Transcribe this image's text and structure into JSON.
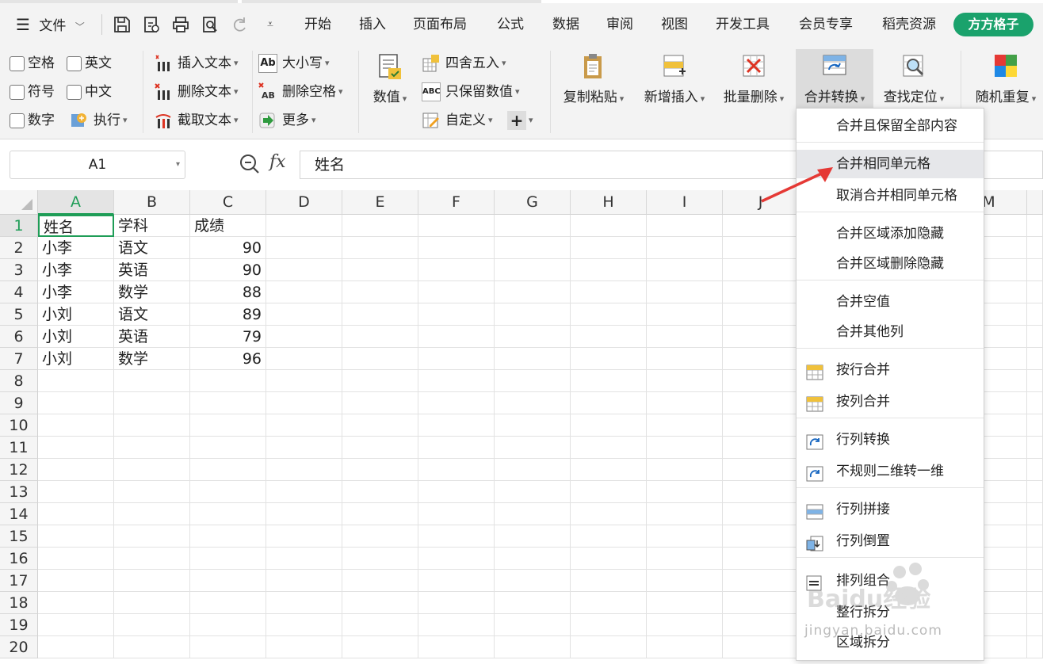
{
  "menu": {
    "file_label": "文件",
    "tabs": [
      "开始",
      "插入",
      "页面布局",
      "公式",
      "数据",
      "审阅",
      "视图",
      "开发工具",
      "会员专享",
      "稻壳资源"
    ],
    "brand": "方方格子"
  },
  "ribbon": {
    "checks": [
      "空格",
      "英文",
      "符号",
      "中文",
      "数字"
    ],
    "execute": "执行",
    "text_ops": [
      "插入文本",
      "删除文本",
      "截取文本"
    ],
    "case_ops": [
      "大小写",
      "删除空格",
      "更多"
    ],
    "value_label": "数值",
    "num_ops": [
      "四舍五入",
      "只保留数值",
      "自定义"
    ],
    "big_buttons": [
      "复制粘贴",
      "新增插入",
      "批量删除",
      "合并转换",
      "查找定位",
      "随机重复"
    ]
  },
  "formula_bar": {
    "cell_ref": "A1",
    "fx": "fx",
    "content": "姓名"
  },
  "columns": [
    "A",
    "B",
    "C",
    "D",
    "E",
    "F",
    "G",
    "H",
    "I",
    "J",
    "M"
  ],
  "rows": [
    "1",
    "2",
    "3",
    "4",
    "5",
    "6",
    "7",
    "8",
    "9",
    "10",
    "11",
    "12",
    "13",
    "14",
    "15",
    "16",
    "17",
    "18",
    "19",
    "20"
  ],
  "table": [
    [
      "姓名",
      "学科",
      "成绩"
    ],
    [
      "小李",
      "语文",
      "90"
    ],
    [
      "小李",
      "英语",
      "90"
    ],
    [
      "小李",
      "数学",
      "88"
    ],
    [
      "小刘",
      "语文",
      "89"
    ],
    [
      "小刘",
      "英语",
      "79"
    ],
    [
      "小刘",
      "数学",
      "96"
    ]
  ],
  "dropdown": {
    "items": [
      "合并且保留全部内容",
      "合并相同单元格",
      "取消合并相同单元格",
      "合并区域添加隐藏",
      "合并区域删除隐藏",
      "合并空值",
      "合并其他列",
      "按行合并",
      "按列合并",
      "行列转换",
      "不规则二维转一维",
      "行列拼接",
      "行列倒置",
      "排列组合",
      "整行拆分",
      "区域拆分"
    ]
  },
  "watermark": {
    "brand": "Baidu经验",
    "url": "jingyan.baidu.com"
  },
  "colors": {
    "accent_green": "#1f9d57",
    "brand_green": "#1aa26c",
    "arrow_red": "#e53935"
  }
}
